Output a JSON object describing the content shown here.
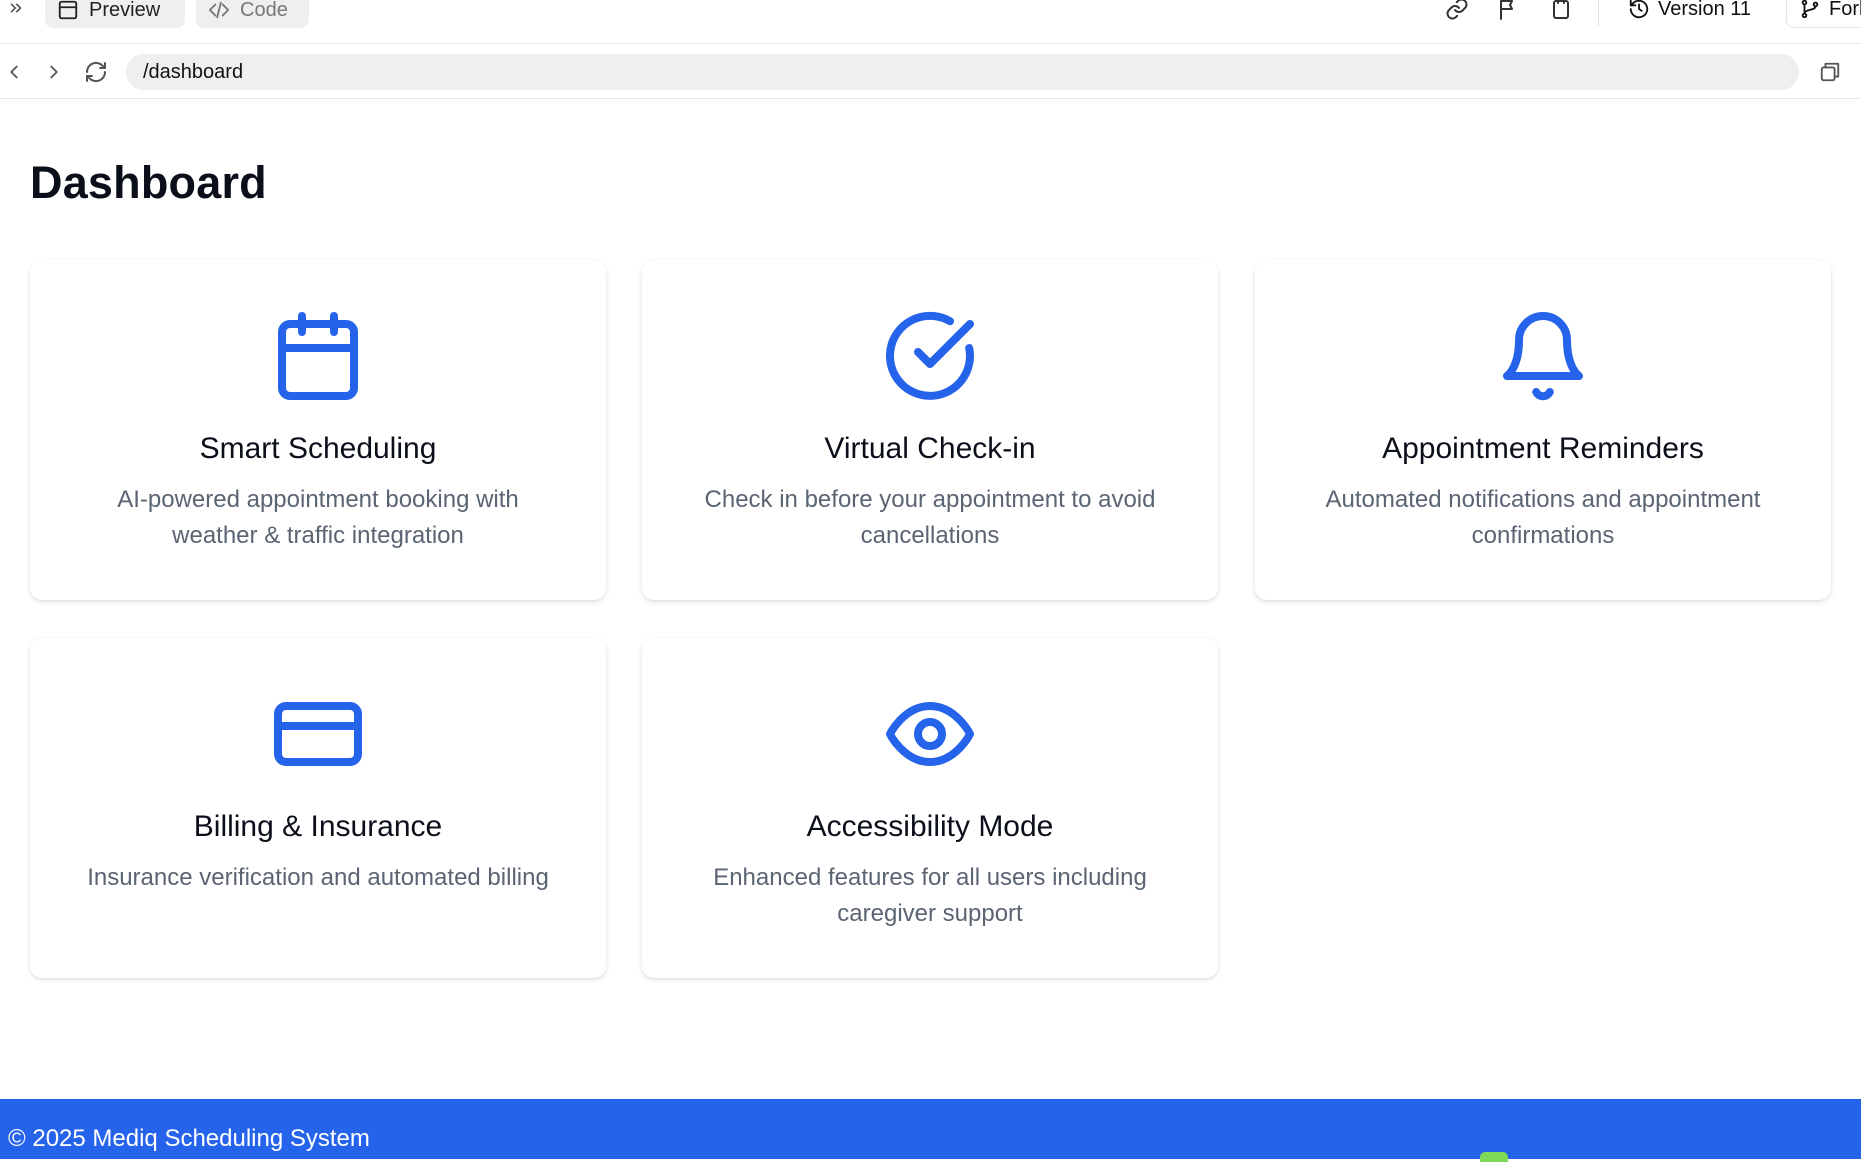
{
  "toolbar": {
    "preview_label": "Preview",
    "code_label": "Code",
    "version_label": "Version 11",
    "fork_label": "Fork"
  },
  "navbar": {
    "url": "/dashboard"
  },
  "main": {
    "title": "Dashboard",
    "cards": [
      {
        "icon": "calendar-icon",
        "title": "Smart Scheduling",
        "description": "AI-powered appointment booking with weather & traffic integration"
      },
      {
        "icon": "check-circle-icon",
        "title": "Virtual Check-in",
        "description": "Check in before your appointment to avoid cancellations"
      },
      {
        "icon": "bell-icon",
        "title": "Appointment Reminders",
        "description": "Automated notifications and appointment confirmations"
      },
      {
        "icon": "credit-card-icon",
        "title": "Billing & Insurance",
        "description": "Insurance verification and automated billing"
      },
      {
        "icon": "eye-icon",
        "title": "Accessibility Mode",
        "description": "Enhanced features for all users including caregiver support"
      }
    ]
  },
  "footer": {
    "text": "© 2025 Mediq Scheduling System"
  },
  "colors": {
    "accent": "#2563eb",
    "footer_bg": "#2563eb",
    "title_text": "#0b0f19",
    "description_text": "#5b6473"
  }
}
